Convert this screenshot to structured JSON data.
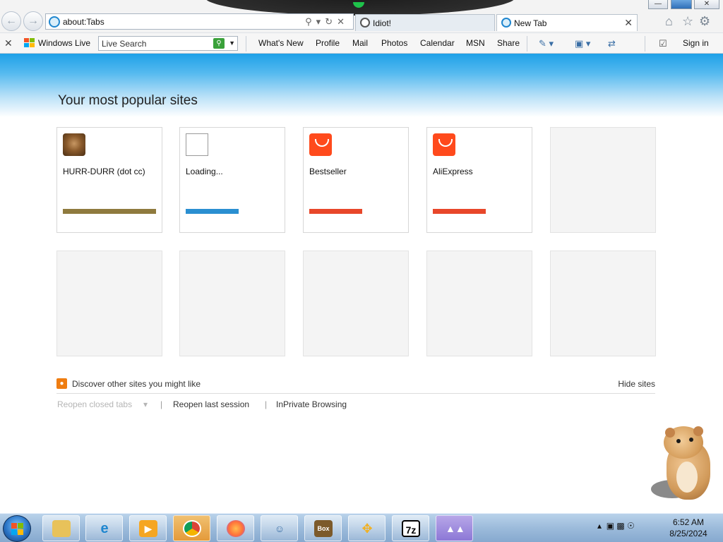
{
  "browser": {
    "address": "about:Tabs",
    "tabs": [
      {
        "label": "Idiot!"
      },
      {
        "label": "New Tab"
      }
    ]
  },
  "commandbar": {
    "windows_live": "Windows Live",
    "search_placeholder": "Live Search",
    "links": [
      "What's New",
      "Profile",
      "Mail",
      "Photos",
      "Calendar",
      "MSN",
      "Share"
    ],
    "sign_in": "Sign in"
  },
  "page": {
    "title": "Your most popular sites",
    "tiles": [
      {
        "label": "HURR-DURR (dot cc)",
        "bar_color": "#8f7a3e"
      },
      {
        "label": "Loading...",
        "bar_color": "#2a8fd1"
      },
      {
        "label": "Bestseller",
        "bar_color": "#e8472a"
      },
      {
        "label": "AliExpress",
        "bar_color": "#e8472a"
      }
    ],
    "discover": "Discover other sites you might like",
    "hide_sites": "Hide sites",
    "reopen_closed": "Reopen closed tabs",
    "reopen_session": "Reopen last session",
    "inprivate": "InPrivate Browsing"
  },
  "taskbar": {
    "apps": [
      "windows-explorer",
      "internet-explorer",
      "media-player",
      "chrome",
      "firefox",
      "network-tool",
      "sandbox",
      "arrows-tool",
      "7zip",
      "vlc-alt"
    ],
    "time": "6:52 AM",
    "date": "8/25/2024"
  }
}
